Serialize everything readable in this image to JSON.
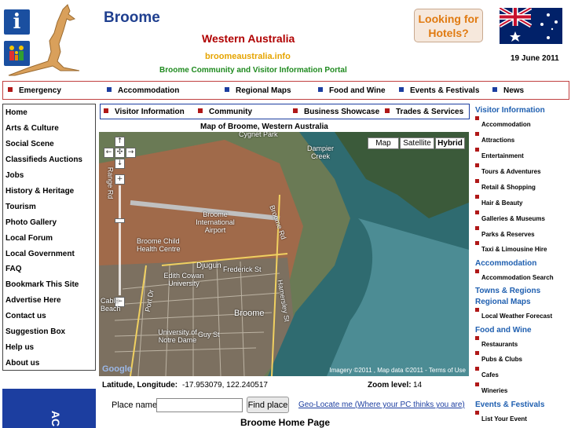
{
  "header": {
    "info_icon": "i",
    "site_title": "Broome",
    "region": "Western Australia",
    "domain": "broomeaustralia.info",
    "portal": "Broome Community and Visitor Information Portal",
    "hotels": "Looking for Hotels?",
    "date": "19 June 2011"
  },
  "topnav": [
    "Emergency",
    "Accommodation",
    "Regional Maps",
    "Food and Wine",
    "Events & Festivals",
    "News"
  ],
  "leftmenu": [
    "Home",
    "Arts & Culture",
    "Social Scene",
    "Classifieds Auctions",
    "Jobs",
    "History & Heritage",
    "Tourism",
    "Photo Gallery",
    "Local Forum",
    "Local Government",
    "FAQ",
    "Bookmark This Site",
    "Advertise Here",
    "Contact us",
    "Suggestion Box",
    "Help us",
    "About us"
  ],
  "left_banner": "AC",
  "secnav": [
    "Visitor Information",
    "Community",
    "Business Showcase",
    "Trades & Services"
  ],
  "map": {
    "caption": "Map of Broome, Western Australia",
    "types": [
      "Map",
      "Satellite",
      "Hybrid"
    ],
    "selected_type": "Hybrid",
    "labels": {
      "cygnet": "Cygnet Park",
      "dampier": "Dampier Creek",
      "airport": "Broome International Airport",
      "child_health": "Broome Child Health Centre",
      "djugun": "Djugun",
      "frederick": "Frederick St",
      "broome_rd": "Broome Rd",
      "edith": "Edith Cowan University",
      "cable_beach": "Cable Beach",
      "broome": "Broome",
      "notre_dame": "University of Notre Dame",
      "guy_st": "Guy St",
      "port_dr": "Port Dr",
      "hamersley": "Hamersley St",
      "range_rd": "Range Rd"
    },
    "credit": "Imagery ©2011 , Map data ©2011 - Terms of Use",
    "google": "Google"
  },
  "coords": {
    "label": "Latitude, Longitude:",
    "value": "-17.953079, 122.240517",
    "zoom_label": "Zoom level:",
    "zoom_value": "14"
  },
  "search": {
    "label": "Place name:",
    "value": "",
    "button": "Find place",
    "geo_link": "Geo-Locate me (Where your PC thinks you are)"
  },
  "home_page": "Broome Home Page",
  "rightcol": {
    "visitor_head": "Visitor Information",
    "visitor_items": [
      "Accommodation",
      "Attractions",
      "Entertainment",
      "Tours & Adventures",
      "Retail & Shopping",
      "Hair & Beauty",
      "Galleries & Museums",
      "Parks & Reserves",
      "Taxi & Limousine Hire"
    ],
    "accom_head": "Accommodation",
    "accom_items": [
      "Accommodation Search"
    ],
    "towns_head": "Towns & Regions",
    "maps_head": "Regional Maps",
    "maps_items": [
      "Local Weather Forecast"
    ],
    "food_head": "Food and Wine",
    "food_items": [
      "Restaurants",
      "Pubs & Clubs",
      "Cafes",
      "Wineries"
    ],
    "events_head": "Events & Festivals",
    "events_items": [
      "List Your Event"
    ]
  }
}
